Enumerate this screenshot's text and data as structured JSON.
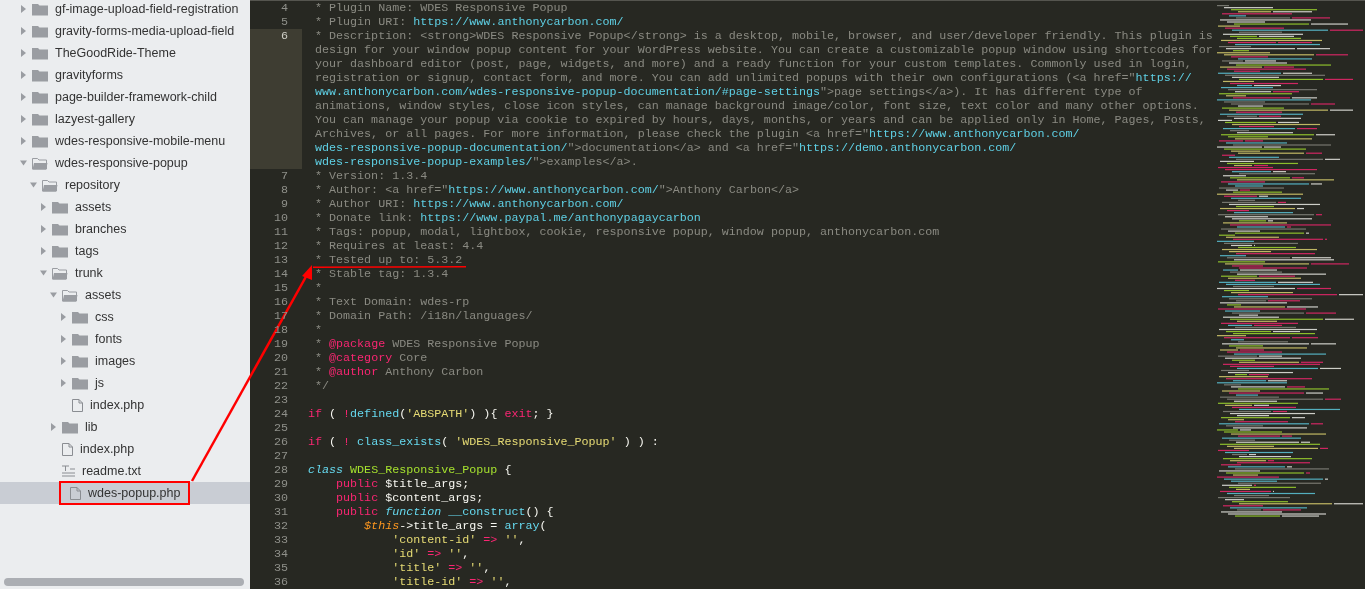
{
  "sidebar": {
    "tree": [
      {
        "label": "gf-image-upload-field-registration",
        "kind": "folder",
        "expanded": false,
        "selected": false
      },
      {
        "label": "gravity-forms-media-upload-field",
        "kind": "folder",
        "expanded": false,
        "selected": false
      },
      {
        "label": "TheGoodRide-Theme",
        "kind": "folder",
        "expanded": false,
        "selected": false
      },
      {
        "label": "gravityforms",
        "kind": "folder",
        "expanded": false,
        "selected": false
      },
      {
        "label": "page-builder-framework-child",
        "kind": "folder",
        "expanded": false,
        "selected": false
      },
      {
        "label": "lazyest-gallery",
        "kind": "folder",
        "expanded": false,
        "selected": false
      },
      {
        "label": "wdes-responsive-mobile-menu",
        "kind": "folder",
        "expanded": false,
        "selected": false
      },
      {
        "label": "wdes-responsive-popup",
        "kind": "folder",
        "expanded": true,
        "selected": false,
        "children": [
          {
            "label": "repository",
            "kind": "folder",
            "expanded": true,
            "selected": false,
            "children": [
              {
                "label": "assets",
                "kind": "folder",
                "expanded": false,
                "selected": false
              },
              {
                "label": "branches",
                "kind": "folder",
                "expanded": false,
                "selected": false
              },
              {
                "label": "tags",
                "kind": "folder",
                "expanded": false,
                "selected": false
              },
              {
                "label": "trunk",
                "kind": "folder",
                "expanded": true,
                "selected": false,
                "children": [
                  {
                    "label": "assets",
                    "kind": "folder",
                    "expanded": true,
                    "selected": false,
                    "children": [
                      {
                        "label": "css",
                        "kind": "folder",
                        "expanded": false,
                        "selected": false
                      },
                      {
                        "label": "fonts",
                        "kind": "folder",
                        "expanded": false,
                        "selected": false
                      },
                      {
                        "label": "images",
                        "kind": "folder",
                        "expanded": false,
                        "selected": false
                      },
                      {
                        "label": "js",
                        "kind": "folder",
                        "expanded": false,
                        "selected": false
                      },
                      {
                        "label": "index.php",
                        "kind": "file",
                        "selected": false
                      }
                    ]
                  },
                  {
                    "label": "lib",
                    "kind": "folder",
                    "expanded": false,
                    "selected": false
                  },
                  {
                    "label": "index.php",
                    "kind": "file",
                    "selected": false
                  },
                  {
                    "label": "readme.txt",
                    "kind": "text",
                    "selected": false
                  },
                  {
                    "label": "wdes-popup.php",
                    "kind": "file",
                    "selected": true
                  }
                ]
              }
            ]
          }
        ]
      }
    ]
  },
  "editor": {
    "lines": [
      {
        "number": "4",
        "current": false,
        "rows": [
          [
            {
              "kind": "comment",
              "text": " * Plugin Name: WDES Responsive Popup"
            }
          ]
        ]
      },
      {
        "number": "5",
        "current": false,
        "rows": [
          [
            {
              "kind": "comment",
              "text": " * Plugin URI: "
            },
            {
              "kind": "link",
              "text": "https://www.anthonycarbon.com/"
            }
          ]
        ]
      },
      {
        "number": "6",
        "current": true,
        "rows": [
          [
            {
              "kind": "comment",
              "text": " * Description: <strong>WDES Responsive Popup</strong> is a desktop, mobile, browser, and user/developer friendly. This plugin is"
            }
          ],
          [
            {
              "kind": "comment",
              "text": "design for your window popup content for your WordPress website. You can create a customizable popup window using shortcodes for"
            }
          ],
          [
            {
              "kind": "comment",
              "text": "your dashboard editor (post, page, widgets, and more) and a ready function for your custom templates. Commonly used in login,"
            }
          ],
          [
            {
              "kind": "comment",
              "text": "registration or signup, contact form, and more. You can add unlimited popups with their own configurations (<a href=\""
            },
            {
              "kind": "link",
              "text": "https://"
            }
          ],
          [
            {
              "kind": "link",
              "text": "www.anthonycarbon.com/wdes-responsive-popup-documentation/#page-settings"
            },
            {
              "kind": "comment",
              "text": "\">page settings</a>). It has different type of"
            }
          ],
          [
            {
              "kind": "comment",
              "text": "animations, window styles, close icon styles, can manage background image/color, font size, text color and many other options."
            }
          ],
          [
            {
              "kind": "comment",
              "text": "You can manage your popup via cookie to expired by hours, days, months, or years and can be applied only in Home, Pages, Posts,"
            }
          ],
          [
            {
              "kind": "comment",
              "text": "Archives, or all pages. For more information, please check the plugin <a href=\""
            },
            {
              "kind": "link",
              "text": "https://www.anthonycarbon.com/"
            }
          ],
          [
            {
              "kind": "link",
              "text": "wdes-responsive-popup-documentation/"
            },
            {
              "kind": "comment",
              "text": "\">documentation</a> and <a href=\""
            },
            {
              "kind": "link",
              "text": "https://demo.anthonycarbon.com/"
            }
          ],
          [
            {
              "kind": "link",
              "text": "wdes-responsive-popup-examples/"
            },
            {
              "kind": "comment",
              "text": "\">examples</a>."
            }
          ]
        ]
      },
      {
        "number": "7",
        "current": false,
        "rows": [
          [
            {
              "kind": "comment",
              "text": " * Version: 1.3.4"
            }
          ]
        ]
      },
      {
        "number": "8",
        "current": false,
        "rows": [
          [
            {
              "kind": "comment",
              "text": " * Author: <a href=\""
            },
            {
              "kind": "link",
              "text": "https://www.anthonycarbon.com/"
            },
            {
              "kind": "comment",
              "text": "\">Anthony Carbon</a>"
            }
          ]
        ]
      },
      {
        "number": "9",
        "current": false,
        "rows": [
          [
            {
              "kind": "comment",
              "text": " * Author URI: "
            },
            {
              "kind": "link",
              "text": "https://www.anthonycarbon.com/"
            }
          ]
        ]
      },
      {
        "number": "10",
        "current": false,
        "rows": [
          [
            {
              "kind": "comment",
              "text": " * Donate link: "
            },
            {
              "kind": "link",
              "text": "https://www.paypal.me/anthonypagaycarbon"
            }
          ]
        ]
      },
      {
        "number": "11",
        "current": false,
        "rows": [
          [
            {
              "kind": "comment",
              "text": " * Tags: popup, modal, lightbox, cookie, responsive popup, window popup, anthonycarbon.com"
            }
          ]
        ]
      },
      {
        "number": "12",
        "current": false,
        "rows": [
          [
            {
              "kind": "comment",
              "text": " * Requires at least: 4.4"
            }
          ]
        ]
      },
      {
        "number": "13",
        "current": false,
        "rows": [
          [
            {
              "kind": "comment",
              "text": " * Tested up to: 5.3.2"
            }
          ]
        ]
      },
      {
        "number": "14",
        "current": false,
        "rows": [
          [
            {
              "kind": "comment",
              "text": " * Stable tag: 1.3.4"
            }
          ]
        ]
      },
      {
        "number": "15",
        "current": false,
        "rows": [
          [
            {
              "kind": "comment",
              "text": " *"
            }
          ]
        ]
      },
      {
        "number": "16",
        "current": false,
        "rows": [
          [
            {
              "kind": "comment",
              "text": " * Text Domain: wdes-rp"
            }
          ]
        ]
      },
      {
        "number": "17",
        "current": false,
        "rows": [
          [
            {
              "kind": "comment",
              "text": " * Domain Path: /i18n/languages/"
            }
          ]
        ]
      },
      {
        "number": "18",
        "current": false,
        "rows": [
          [
            {
              "kind": "comment",
              "text": " *"
            }
          ]
        ]
      },
      {
        "number": "19",
        "current": false,
        "rows": [
          [
            {
              "kind": "comment",
              "text": " * "
            },
            {
              "kind": "keyword",
              "text": "@package"
            },
            {
              "kind": "comment",
              "text": " WDES Responsive Popup"
            }
          ]
        ]
      },
      {
        "number": "20",
        "current": false,
        "rows": [
          [
            {
              "kind": "comment",
              "text": " * "
            },
            {
              "kind": "keyword",
              "text": "@category"
            },
            {
              "kind": "comment",
              "text": " Core"
            }
          ]
        ]
      },
      {
        "number": "21",
        "current": false,
        "rows": [
          [
            {
              "kind": "comment",
              "text": " * "
            },
            {
              "kind": "keyword",
              "text": "@author"
            },
            {
              "kind": "comment",
              "text": " Anthony Carbon"
            }
          ]
        ]
      },
      {
        "number": "22",
        "current": false,
        "rows": [
          [
            {
              "kind": "comment",
              "text": " */"
            }
          ]
        ]
      },
      {
        "number": "23",
        "current": false,
        "rows": [
          []
        ]
      },
      {
        "number": "24",
        "current": false,
        "rows": [
          [
            {
              "kind": "keyword",
              "text": "if"
            },
            {
              "kind": "plain",
              "text": " ( "
            },
            {
              "kind": "keyword",
              "text": "!"
            },
            {
              "kind": "func",
              "text": "defined"
            },
            {
              "kind": "plain",
              "text": "("
            },
            {
              "kind": "string",
              "text": "'ABSPATH'"
            },
            {
              "kind": "plain",
              "text": ") ){ "
            },
            {
              "kind": "keyword",
              "text": "exit"
            },
            {
              "kind": "plain",
              "text": "; }"
            }
          ]
        ]
      },
      {
        "number": "25",
        "current": false,
        "rows": [
          []
        ]
      },
      {
        "number": "26",
        "current": false,
        "rows": [
          [
            {
              "kind": "keyword",
              "text": "if"
            },
            {
              "kind": "plain",
              "text": " ( "
            },
            {
              "kind": "keyword",
              "text": "!"
            },
            {
              "kind": "plain",
              "text": " "
            },
            {
              "kind": "func",
              "text": "class_exists"
            },
            {
              "kind": "plain",
              "text": "( "
            },
            {
              "kind": "string",
              "text": "'WDES_Responsive_Popup'"
            },
            {
              "kind": "plain",
              "text": " ) ) :"
            }
          ]
        ]
      },
      {
        "number": "27",
        "current": false,
        "rows": [
          []
        ]
      },
      {
        "number": "28",
        "current": false,
        "rows": [
          [
            {
              "kind": "storage",
              "text": "class"
            },
            {
              "kind": "plain",
              "text": " "
            },
            {
              "kind": "classname",
              "text": "WDES_Responsive_Popup"
            },
            {
              "kind": "plain",
              "text": " {"
            }
          ]
        ]
      },
      {
        "number": "29",
        "current": false,
        "rows": [
          [
            {
              "kind": "plain",
              "text": "    "
            },
            {
              "kind": "keyword",
              "text": "public"
            },
            {
              "kind": "plain",
              "text": " $title_args;"
            }
          ]
        ]
      },
      {
        "number": "30",
        "current": false,
        "rows": [
          [
            {
              "kind": "plain",
              "text": "    "
            },
            {
              "kind": "keyword",
              "text": "public"
            },
            {
              "kind": "plain",
              "text": " $content_args;"
            }
          ]
        ]
      },
      {
        "number": "31",
        "current": false,
        "rows": [
          [
            {
              "kind": "plain",
              "text": "    "
            },
            {
              "kind": "keyword",
              "text": "public"
            },
            {
              "kind": "plain",
              "text": " "
            },
            {
              "kind": "storage",
              "text": "function"
            },
            {
              "kind": "plain",
              "text": " "
            },
            {
              "kind": "func",
              "text": "__construct"
            },
            {
              "kind": "plain",
              "text": "() {"
            }
          ]
        ]
      },
      {
        "number": "32",
        "current": false,
        "rows": [
          [
            {
              "kind": "plain",
              "text": "        "
            },
            {
              "kind": "variable",
              "text": "$this"
            },
            {
              "kind": "plain",
              "text": "->title_args = "
            },
            {
              "kind": "func",
              "text": "array"
            },
            {
              "kind": "plain",
              "text": "("
            }
          ]
        ]
      },
      {
        "number": "33",
        "current": false,
        "rows": [
          [
            {
              "kind": "plain",
              "text": "            "
            },
            {
              "kind": "string",
              "text": "'content-id'"
            },
            {
              "kind": "plain",
              "text": " "
            },
            {
              "kind": "keyword",
              "text": "=>"
            },
            {
              "kind": "plain",
              "text": " "
            },
            {
              "kind": "string",
              "text": "''"
            },
            {
              "kind": "plain",
              "text": ","
            }
          ]
        ]
      },
      {
        "number": "34",
        "current": false,
        "rows": [
          [
            {
              "kind": "plain",
              "text": "            "
            },
            {
              "kind": "string",
              "text": "'id'"
            },
            {
              "kind": "plain",
              "text": " "
            },
            {
              "kind": "keyword",
              "text": "=>"
            },
            {
              "kind": "plain",
              "text": " "
            },
            {
              "kind": "string",
              "text": "''"
            },
            {
              "kind": "plain",
              "text": ","
            }
          ]
        ]
      },
      {
        "number": "35",
        "current": false,
        "rows": [
          [
            {
              "kind": "plain",
              "text": "            "
            },
            {
              "kind": "string",
              "text": "'title'"
            },
            {
              "kind": "plain",
              "text": " "
            },
            {
              "kind": "keyword",
              "text": "=>"
            },
            {
              "kind": "plain",
              "text": " "
            },
            {
              "kind": "string",
              "text": "''"
            },
            {
              "kind": "plain",
              "text": ","
            }
          ]
        ]
      },
      {
        "number": "36",
        "current": false,
        "rows": [
          [
            {
              "kind": "plain",
              "text": "            "
            },
            {
              "kind": "string",
              "text": "'title-id'"
            },
            {
              "kind": "plain",
              "text": " "
            },
            {
              "kind": "keyword",
              "text": "=>"
            },
            {
              "kind": "plain",
              "text": " "
            },
            {
              "kind": "string",
              "text": "''"
            },
            {
              "kind": "plain",
              "text": ","
            }
          ]
        ]
      }
    ]
  }
}
